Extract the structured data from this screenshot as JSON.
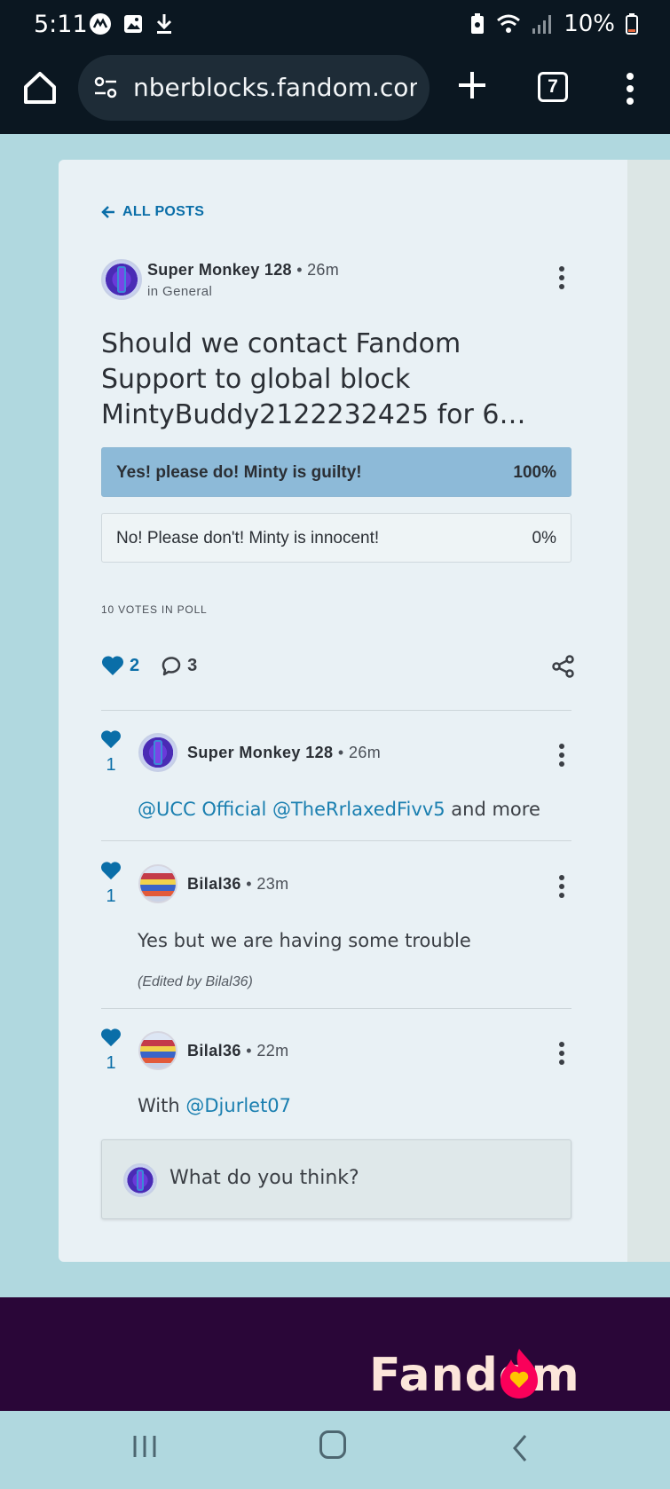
{
  "status_bar": {
    "time": "5:11",
    "battery": "10%",
    "left_icons": [
      "messenger-icon",
      "gallery-icon",
      "download-icon"
    ],
    "right_icons": [
      "battery-saver-icon",
      "wifi-icon",
      "signal-icon",
      "battery-icon"
    ]
  },
  "browser": {
    "url": "nberblocks.fandom.com",
    "tab_count": "7"
  },
  "post": {
    "back_label": "ALL POSTS",
    "author": "Super Monkey 128",
    "time": "26m",
    "category": "in General",
    "title": "Should we contact Fandom Support to global block MintyBuddy2122232425 for 6…",
    "poll": [
      {
        "label": "Yes! please do! Minty is guilty!",
        "percent": "100%",
        "winner": true
      },
      {
        "label": "No! Please don't! Minty is innocent!",
        "percent": "0%",
        "winner": false
      }
    ],
    "votes_label": "10 VOTES IN POLL",
    "likes": "2",
    "comments": "3"
  },
  "replies": [
    {
      "likes": "1",
      "author": "Super Monkey 128",
      "time": "26m",
      "mention1": "@UCC Official",
      "mention2": "@TheRrlaxedFivv5",
      "suffix": "and more"
    },
    {
      "likes": "1",
      "author": "Bilal36",
      "time": "23m",
      "body": "Yes but we are having some trouble",
      "edited": "(Edited by Bilal36)"
    },
    {
      "likes": "1",
      "author": "Bilal36",
      "time": "22m",
      "prefix": "With",
      "mention": "@Djurlet07"
    }
  ],
  "comment_box": {
    "placeholder": "What do you think?"
  },
  "footer": {
    "logo_text": "Fandom"
  },
  "colors": {
    "accent": "#0a6ea8",
    "poll_winner": "#8dbad8",
    "page_bg": "#b0d8df",
    "footer_bg": "#2a0638"
  }
}
